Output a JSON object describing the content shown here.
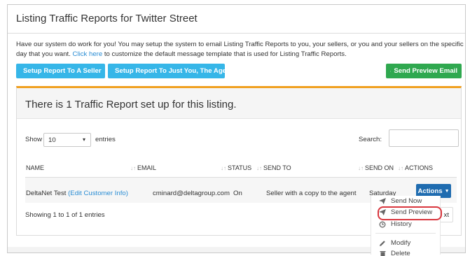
{
  "header": {
    "title": "Listing Traffic Reports for Twitter Street"
  },
  "intro": {
    "text_before": "Have our system do work for you! You may setup the system to email Listing Traffic Reports to you, your sellers, or you and your sellers on the specific day that you want. ",
    "link": "Click here",
    "text_after": " to customize the default message template that is used for Listing Traffic Reports."
  },
  "buttons": {
    "setup_seller": "Setup Report To A Seller",
    "setup_agent": "Setup Report To Just You, The Agent",
    "send_preview_email": "Send Preview Email"
  },
  "panel": {
    "title": "There is 1 Traffic Report set up for this listing.",
    "show_label": "Show",
    "entries_value": "10",
    "entries_label": "entries",
    "search_label": "Search:",
    "search_value": ""
  },
  "table": {
    "columns": [
      "NAME",
      "EMAIL",
      "STATUS",
      "SEND TO",
      "SEND ON",
      "ACTIONS"
    ],
    "row": {
      "name": "DeltaNet Test",
      "edit_link": "(Edit Customer Info)",
      "email": "cminard@deltagroup.com",
      "status": "On",
      "send_to": "Seller with a copy to the agent",
      "send_on": "Saturday",
      "actions_label": "Actions"
    },
    "info": "Showing 1 to 1 of 1 entries",
    "pager_next_partial": "xt"
  },
  "actions_menu": {
    "items": [
      {
        "label": "Send Now",
        "icon": "send-icon"
      },
      {
        "label": "Send Preview",
        "icon": "send-icon"
      },
      {
        "label": "History",
        "icon": "history-icon"
      },
      {
        "label": "Modify",
        "icon": "pencil-icon"
      },
      {
        "label": "Delete",
        "icon": "trash-icon"
      }
    ],
    "highlighted_item": "Send Preview"
  },
  "colors": {
    "accent_cyan": "#36b6e8",
    "accent_green": "#2fa84f",
    "panel_border_orange": "#f0a020",
    "actions_blue": "#1f6cb0",
    "highlight_red": "#d9363e",
    "link_blue": "#2a8dd4"
  }
}
